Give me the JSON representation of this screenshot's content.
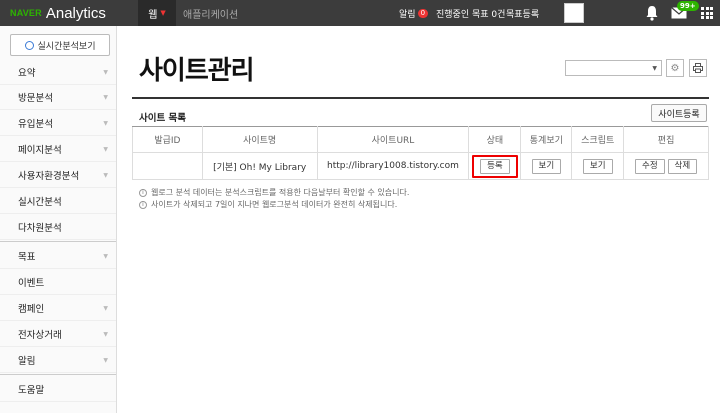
{
  "topbar": {
    "brand_naver": "NAVER",
    "brand_analytics": "Analytics",
    "tab_web": "웹",
    "tab_app": "애플리케이션",
    "alarm_label": "알림",
    "alarm_count": "0",
    "goal_progress": "진행중인 목표 0건",
    "goal_register": "목표등록",
    "mail_badge": "99+"
  },
  "sidebar": {
    "realtime_button": "실시간분석보기",
    "items": [
      {
        "label": "요약",
        "chevron": true
      },
      {
        "label": "방문분석",
        "chevron": true
      },
      {
        "label": "유입분석",
        "chevron": true
      },
      {
        "label": "페이지분석",
        "chevron": true
      },
      {
        "label": "사용자환경분석",
        "chevron": true
      },
      {
        "label": "실시간분석",
        "chevron": false
      },
      {
        "label": "다차원분석",
        "chevron": false
      },
      {
        "label": "목표",
        "chevron": true
      },
      {
        "label": "이벤트",
        "chevron": false
      },
      {
        "label": "캠페인",
        "chevron": true
      },
      {
        "label": "전자상거래",
        "chevron": true
      },
      {
        "label": "알림",
        "chevron": true
      },
      {
        "label": "도움말",
        "chevron": false
      }
    ]
  },
  "main": {
    "page_title": "사이트관리",
    "section_title": "사이트 목록",
    "add_site_button": "사이트등록",
    "table": {
      "headers": [
        "발급ID",
        "사이트명",
        "사이트URL",
        "상태",
        "통계보기",
        "스크립트",
        "편집"
      ],
      "rows": [
        {
          "id": "",
          "name": "[기본] Oh! My Library",
          "url": "http://library1008.tistory.com",
          "status_button": "등록",
          "stats_button": "보기",
          "script_button": "보기",
          "edit_button": "수정",
          "delete_button": "삭제"
        }
      ]
    },
    "notes": [
      "웹로그 분석 데이터는 분석스크립트를 적용한 다음날부터 확인할 수 있습니다.",
      "사이트가 삭제되고 7일이 지나면 웹로그분석 데이터가 완전히 삭제됩니다."
    ]
  },
  "colors": {
    "topbar_bg": "#3c3c3c",
    "brand_green": "#2db400",
    "alert_red": "#e00000"
  }
}
